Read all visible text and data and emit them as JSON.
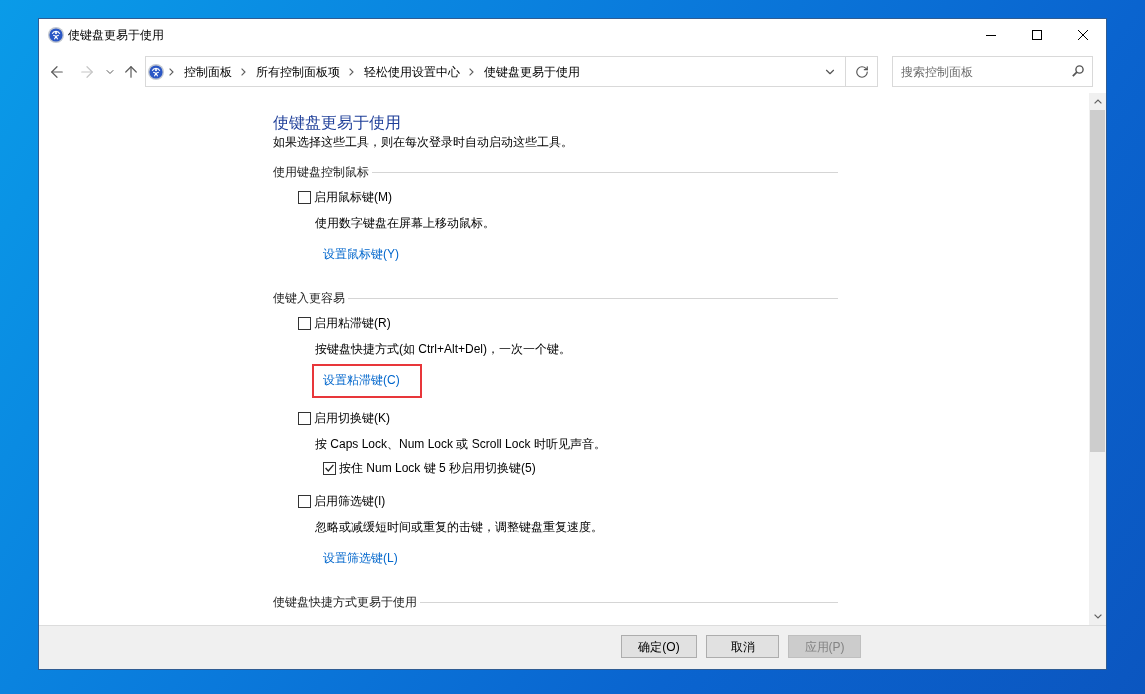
{
  "window": {
    "title": "使键盘更易于使用"
  },
  "navigation": {
    "buttons": [
      {
        "kind": "back",
        "disabled": false
      },
      {
        "kind": "forward",
        "disabled": true
      },
      {
        "kind": "recent",
        "disabled": false
      },
      {
        "kind": "up",
        "disabled": false
      }
    ]
  },
  "address_bar": {
    "breadcrumbs": [
      "控制面板",
      "所有控制面板项",
      "轻松使用设置中心",
      "使键盘更易于使用"
    ]
  },
  "search": {
    "placeholder": "搜索控制面板"
  },
  "page": {
    "heading": "使键盘更易于使用",
    "intro": "如果选择这些工具，则在每次登录时自动启动这些工具。",
    "sections": [
      {
        "title": "使用键盘控制鼠标",
        "items": [
          {
            "kind": "checkbox",
            "label": "启用鼠标键(M)",
            "checked": false
          },
          {
            "kind": "description",
            "text": "使用数字键盘在屏幕上移动鼠标。"
          },
          {
            "kind": "link",
            "text": "设置鼠标键(Y)",
            "highlighted": false
          }
        ]
      },
      {
        "title": "使键入更容易",
        "items": [
          {
            "kind": "checkbox",
            "label": "启用粘滞键(R)",
            "checked": false
          },
          {
            "kind": "description",
            "text": "按键盘快捷方式(如 Ctrl+Alt+Del)，一次一个键。"
          },
          {
            "kind": "link",
            "text": "设置粘滞键(C)",
            "highlighted": true
          },
          {
            "kind": "checkbox",
            "label": "启用切换键(K)",
            "checked": false
          },
          {
            "kind": "description",
            "text": "按 Caps Lock、Num Lock 或 Scroll Lock 时听见声音。"
          },
          {
            "kind": "sub_checkbox",
            "label": "按住 Num Lock 键 5 秒启用切换键(5)",
            "checked": true
          },
          {
            "kind": "checkbox",
            "label": "启用筛选键(I)",
            "checked": false
          },
          {
            "kind": "description",
            "text": "忽略或减缓短时间或重复的击键，调整键盘重复速度。"
          },
          {
            "kind": "link",
            "text": "设置筛选键(L)",
            "highlighted": false
          }
        ]
      },
      {
        "title": "使键盘快捷方式更易于使用"
      }
    ]
  },
  "footer": {
    "buttons": [
      {
        "label": "确定(O)",
        "disabled": false
      },
      {
        "label": "取消",
        "disabled": false
      },
      {
        "label": "应用(P)",
        "disabled": true
      }
    ]
  }
}
